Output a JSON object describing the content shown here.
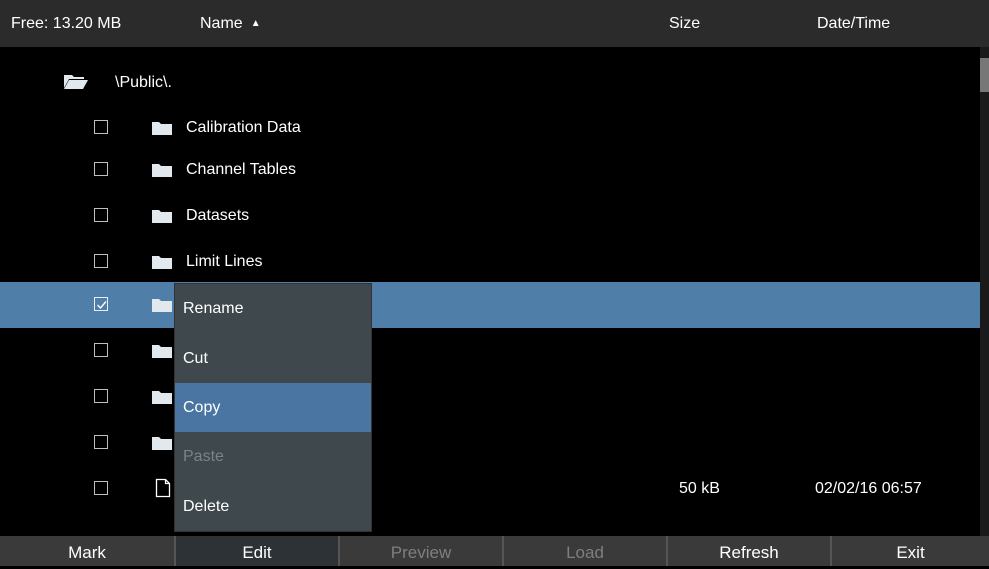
{
  "header": {
    "free_label": "Free: 13.20 MB",
    "name_label": "Name",
    "size_label": "Size",
    "datetime_label": "Date/Time"
  },
  "path": {
    "label": "\\Public\\."
  },
  "rows": [
    {
      "name": "Calibration Data",
      "type": "folder",
      "checked": false,
      "size": "",
      "date": ""
    },
    {
      "name": "Channel Tables",
      "type": "folder",
      "checked": false,
      "size": "",
      "date": ""
    },
    {
      "name": "Datasets",
      "type": "folder",
      "checked": false,
      "size": "",
      "date": ""
    },
    {
      "name": "Limit Lines",
      "type": "folder",
      "checked": false,
      "size": "",
      "date": ""
    },
    {
      "name": "",
      "type": "folder",
      "checked": true,
      "size": "",
      "date": ""
    },
    {
      "name": "",
      "type": "folder",
      "checked": false,
      "size": "",
      "date": ""
    },
    {
      "name": "",
      "type": "folder",
      "checked": false,
      "size": "",
      "date": ""
    },
    {
      "name": "",
      "type": "folder",
      "checked": false,
      "size": "",
      "date": ""
    },
    {
      "name": "",
      "type": "file",
      "checked": false,
      "size": "50 kB",
      "date": "02/02/16 06:57"
    }
  ],
  "context_menu": {
    "items": [
      {
        "label": "Rename",
        "state": "normal"
      },
      {
        "label": "Cut",
        "state": "normal"
      },
      {
        "label": "Copy",
        "state": "highlighted"
      },
      {
        "label": "Paste",
        "state": "disabled"
      },
      {
        "label": "Delete",
        "state": "normal"
      }
    ]
  },
  "softkeys": [
    {
      "label": "Mark",
      "enabled": true
    },
    {
      "label": "Edit",
      "enabled": true
    },
    {
      "label": "Preview",
      "enabled": false
    },
    {
      "label": "Load",
      "enabled": false
    },
    {
      "label": "Refresh",
      "enabled": true
    },
    {
      "label": "Exit",
      "enabled": true
    }
  ],
  "colors": {
    "selection": "#4f7ea8",
    "menu_bg": "#3f484c",
    "menu_highlight": "#4a75a2",
    "folder_icon": "#e1e8ee"
  }
}
